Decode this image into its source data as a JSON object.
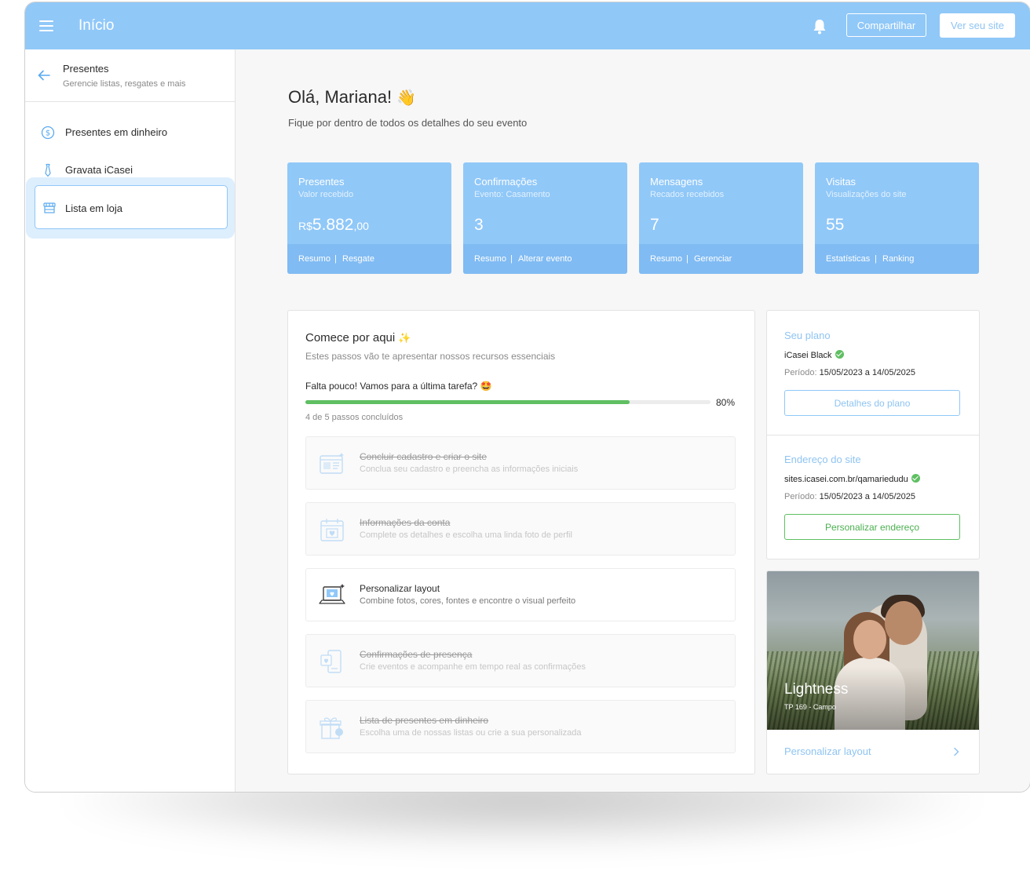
{
  "topbar": {
    "title": "Início",
    "share_label": "Compartilhar",
    "view_site_label": "Ver seu site"
  },
  "sidebar": {
    "title": "Presentes",
    "subtitle": "Gerencie listas, resgates e mais",
    "items": [
      {
        "label": "Presentes em dinheiro",
        "icon": "dollar-circle-icon"
      },
      {
        "label": "Gravata iCasei",
        "icon": "tie-icon"
      },
      {
        "label": "Lista em loja",
        "icon": "store-icon",
        "active": true
      }
    ]
  },
  "main": {
    "greeting": "Olá, Mariana!",
    "greeting_emoji": "👋",
    "subtitle": "Fique por dentro de todos os detalhes do seu evento"
  },
  "stats": [
    {
      "title": "Presentes",
      "subtitle": "Valor recebido",
      "currency": "R$",
      "value": "5.882",
      "cents": ",00",
      "links": [
        "Resumo",
        "Resgate"
      ]
    },
    {
      "title": "Confirmações",
      "subtitle": "Evento: Casamento",
      "value": "3",
      "links": [
        "Resumo",
        "Alterar evento"
      ]
    },
    {
      "title": "Mensagens",
      "subtitle": "Recados recebidos",
      "value": "7",
      "links": [
        "Resumo",
        "Gerenciar"
      ]
    },
    {
      "title": "Visitas",
      "subtitle": "Visualizações do site",
      "value": "55",
      "links": [
        "Estatísticas",
        "Ranking"
      ]
    }
  ],
  "start": {
    "title": "Comece por aqui",
    "title_emoji": "✨",
    "subtitle": "Estes passos vão te apresentar nossos recursos essenciais",
    "progress_text": "Falta pouco! Vamos para a última tarefa? 🤩",
    "progress_percent": 80,
    "progress_label": "80%",
    "steps_done": "4 de 5 passos concluídos",
    "tasks": [
      {
        "title": "Concluir cadastro e criar o site",
        "desc": "Conclua seu cadastro e preencha as informações iniciais",
        "done": true,
        "icon": "website-icon"
      },
      {
        "title": "Informações da conta",
        "desc": "Complete os detalhes e escolha uma linda foto de perfil",
        "done": true,
        "icon": "calendar-heart-icon"
      },
      {
        "title": "Personalizar layout",
        "desc": "Combine fotos, cores, fontes e encontre o visual perfeito",
        "done": false,
        "icon": "laptop-heart-icon"
      },
      {
        "title": "Confirmações de presença",
        "desc": "Crie eventos e acompanhe em tempo real as confirmações",
        "done": true,
        "icon": "devices-icon"
      },
      {
        "title": "Lista de presentes em dinheiro",
        "desc": "Escolha uma de nossas listas ou crie a sua personalizada",
        "done": true,
        "icon": "gift-icon"
      }
    ]
  },
  "plan": {
    "heading": "Seu plano",
    "name": "iCasei Black",
    "period_label": "Período:",
    "period_value": "15/05/2023 a 14/05/2025",
    "button": "Detalhes do plano"
  },
  "address": {
    "heading": "Endereço do site",
    "url": "sites.icasei.com.br/qamariedudu",
    "period_label": "Período:",
    "period_value": "15/05/2023 a 14/05/2025",
    "button": "Personalizar endereço"
  },
  "layout_card": {
    "photo_title": "Lightness",
    "photo_sub": "TP 169 - Campo",
    "link": "Personalizar layout"
  },
  "colors": {
    "accent": "#90c8f8",
    "accent_dark": "#80bbf3",
    "success": "#5fbf62"
  }
}
